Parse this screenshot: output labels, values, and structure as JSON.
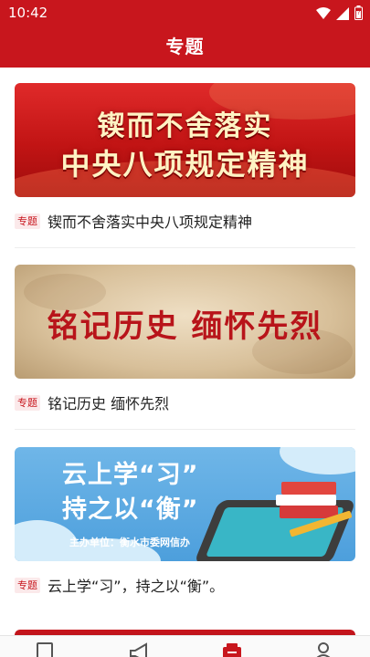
{
  "status_bar": {
    "time": "10:42",
    "icons": [
      "wifi-icon",
      "signal-icon",
      "battery-icon"
    ]
  },
  "header": {
    "title": "专题"
  },
  "feed": {
    "items": [
      {
        "tag": "专题",
        "title": "锲而不舍落实中央八项规定精神",
        "banner": {
          "line1": "锲而不舍落实",
          "line2": "中央八项规定精神"
        }
      },
      {
        "tag": "专题",
        "title": "铭记历史 缅怀先烈",
        "banner": {
          "text": "铭记历史  缅怀先烈"
        }
      },
      {
        "tag": "专题",
        "title": "云上学“习”，持之以“衡”。",
        "banner": {
          "line1": "云上学“习”",
          "line2": "持之以“衡”",
          "sponsor": "主办单位：衡水市委网信办"
        }
      }
    ]
  },
  "tab_bar": {
    "tabs": [
      {
        "icon": "bookmark-icon",
        "active": false
      },
      {
        "icon": "megaphone-icon",
        "active": false
      },
      {
        "icon": "topics-icon",
        "active": true
      },
      {
        "icon": "person-icon",
        "active": false
      }
    ]
  },
  "colors": {
    "brand_red": "#c8161d",
    "tag_bg": "#fbe9ea",
    "title_text": "#222222"
  }
}
